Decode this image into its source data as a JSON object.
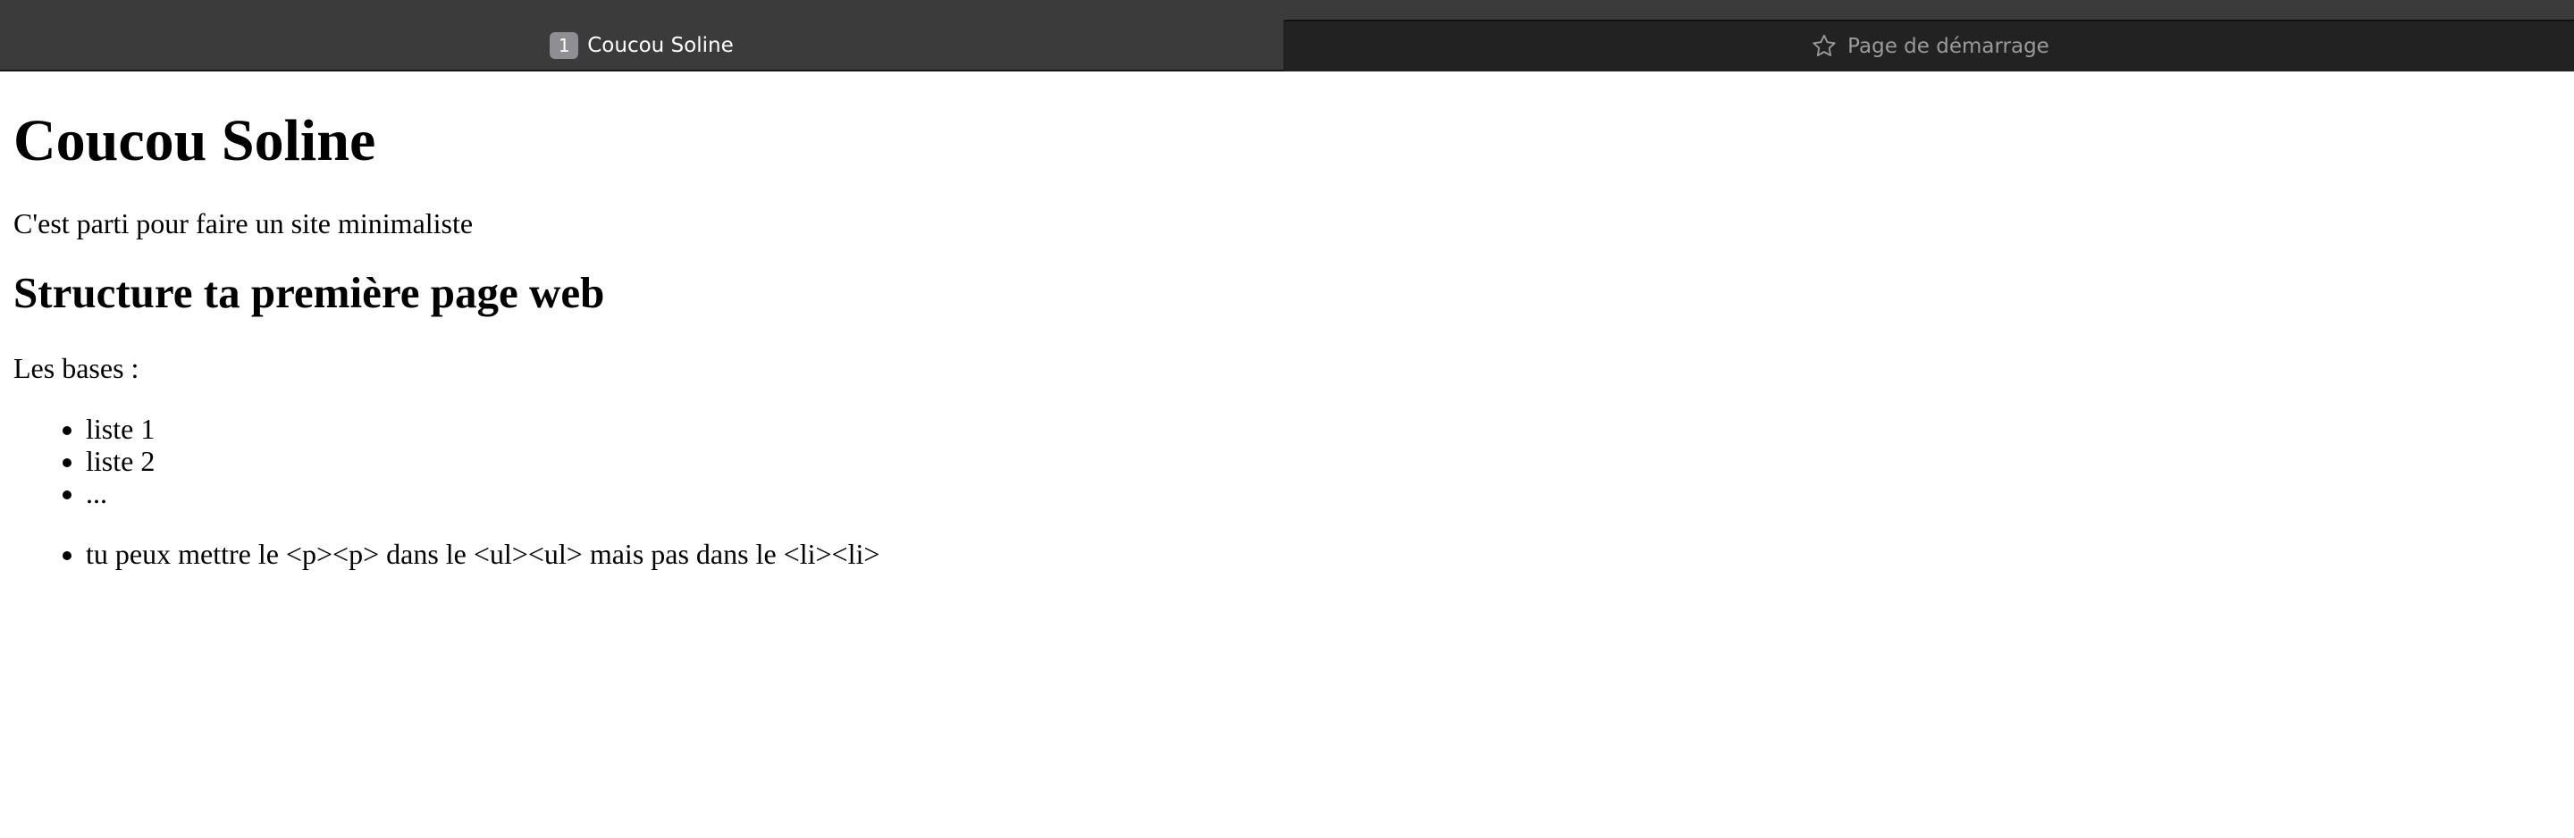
{
  "tabs": [
    {
      "index": "1",
      "label": "Coucou Soline",
      "active": true
    },
    {
      "label": "Page de démarrage",
      "icon": "star-icon",
      "active": false
    }
  ],
  "page": {
    "heading": "Coucou Soline",
    "intro": "C'est parti pour faire un site minimaliste",
    "subheading": "Structure ta première page web",
    "bases_label": "Les bases :",
    "list1": [
      "liste 1",
      "liste 2",
      "..."
    ],
    "list2": [
      "tu peux mettre le <p><p> dans le <ul><ul> mais pas dans le <li><li>"
    ]
  },
  "colors": {
    "tabbar_bg": "#3b3b3b",
    "inactive_tab_bg": "#222222",
    "index_badge_bg": "#8e8e93"
  }
}
